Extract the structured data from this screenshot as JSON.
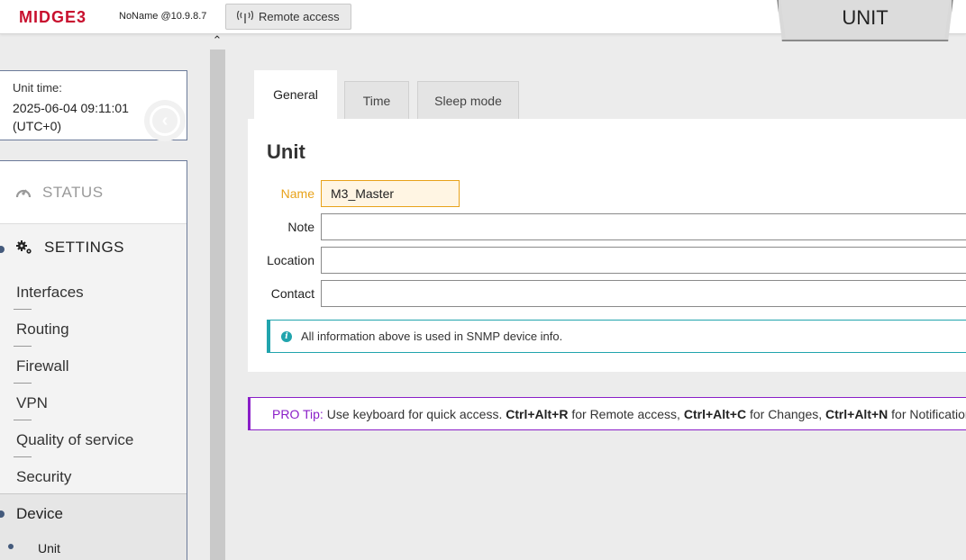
{
  "header": {
    "logo": "MIDGE3",
    "hostname": "NoName @10.9.8.7",
    "remote_access_label": "Remote access",
    "unit_tab_label": "UNIT"
  },
  "sidebar": {
    "time_label": "Unit time:",
    "time_value": "2025-06-04 09:11:01",
    "time_zone": "(UTC+0)",
    "status_label": "STATUS",
    "settings_label": "SETTINGS",
    "settings_items": [
      "Interfaces",
      "Routing",
      "Firewall",
      "VPN",
      "Quality of service",
      "Security"
    ],
    "device_label": "Device",
    "unit_label": "Unit"
  },
  "tabs": [
    {
      "label": "General",
      "active": true
    },
    {
      "label": "Time",
      "active": false
    },
    {
      "label": "Sleep mode",
      "active": false
    }
  ],
  "panel": {
    "title": "Unit",
    "fields": {
      "name": {
        "label": "Name",
        "value": "M3_Master"
      },
      "note": {
        "label": "Note",
        "value": ""
      },
      "location": {
        "label": "Location",
        "value": ""
      },
      "contact": {
        "label": "Contact",
        "value": ""
      }
    },
    "info_text": "All information above is used in SNMP device info."
  },
  "pro_tip": {
    "label": "PRO Tip:",
    "intro": "Use keyboard for quick access.",
    "k1": "Ctrl+Alt+R",
    "t1": "for Remote access,",
    "k2": "Ctrl+Alt+C",
    "t2": "for Changes,",
    "k3": "Ctrl+Alt+N",
    "t3": "for Notification"
  },
  "colors": {
    "brand": "#c8102e",
    "field_active": "#e8a21a",
    "info": "#21a4ad",
    "pro_tip": "#8a1ec8",
    "nav_dot": "#445a7c"
  }
}
